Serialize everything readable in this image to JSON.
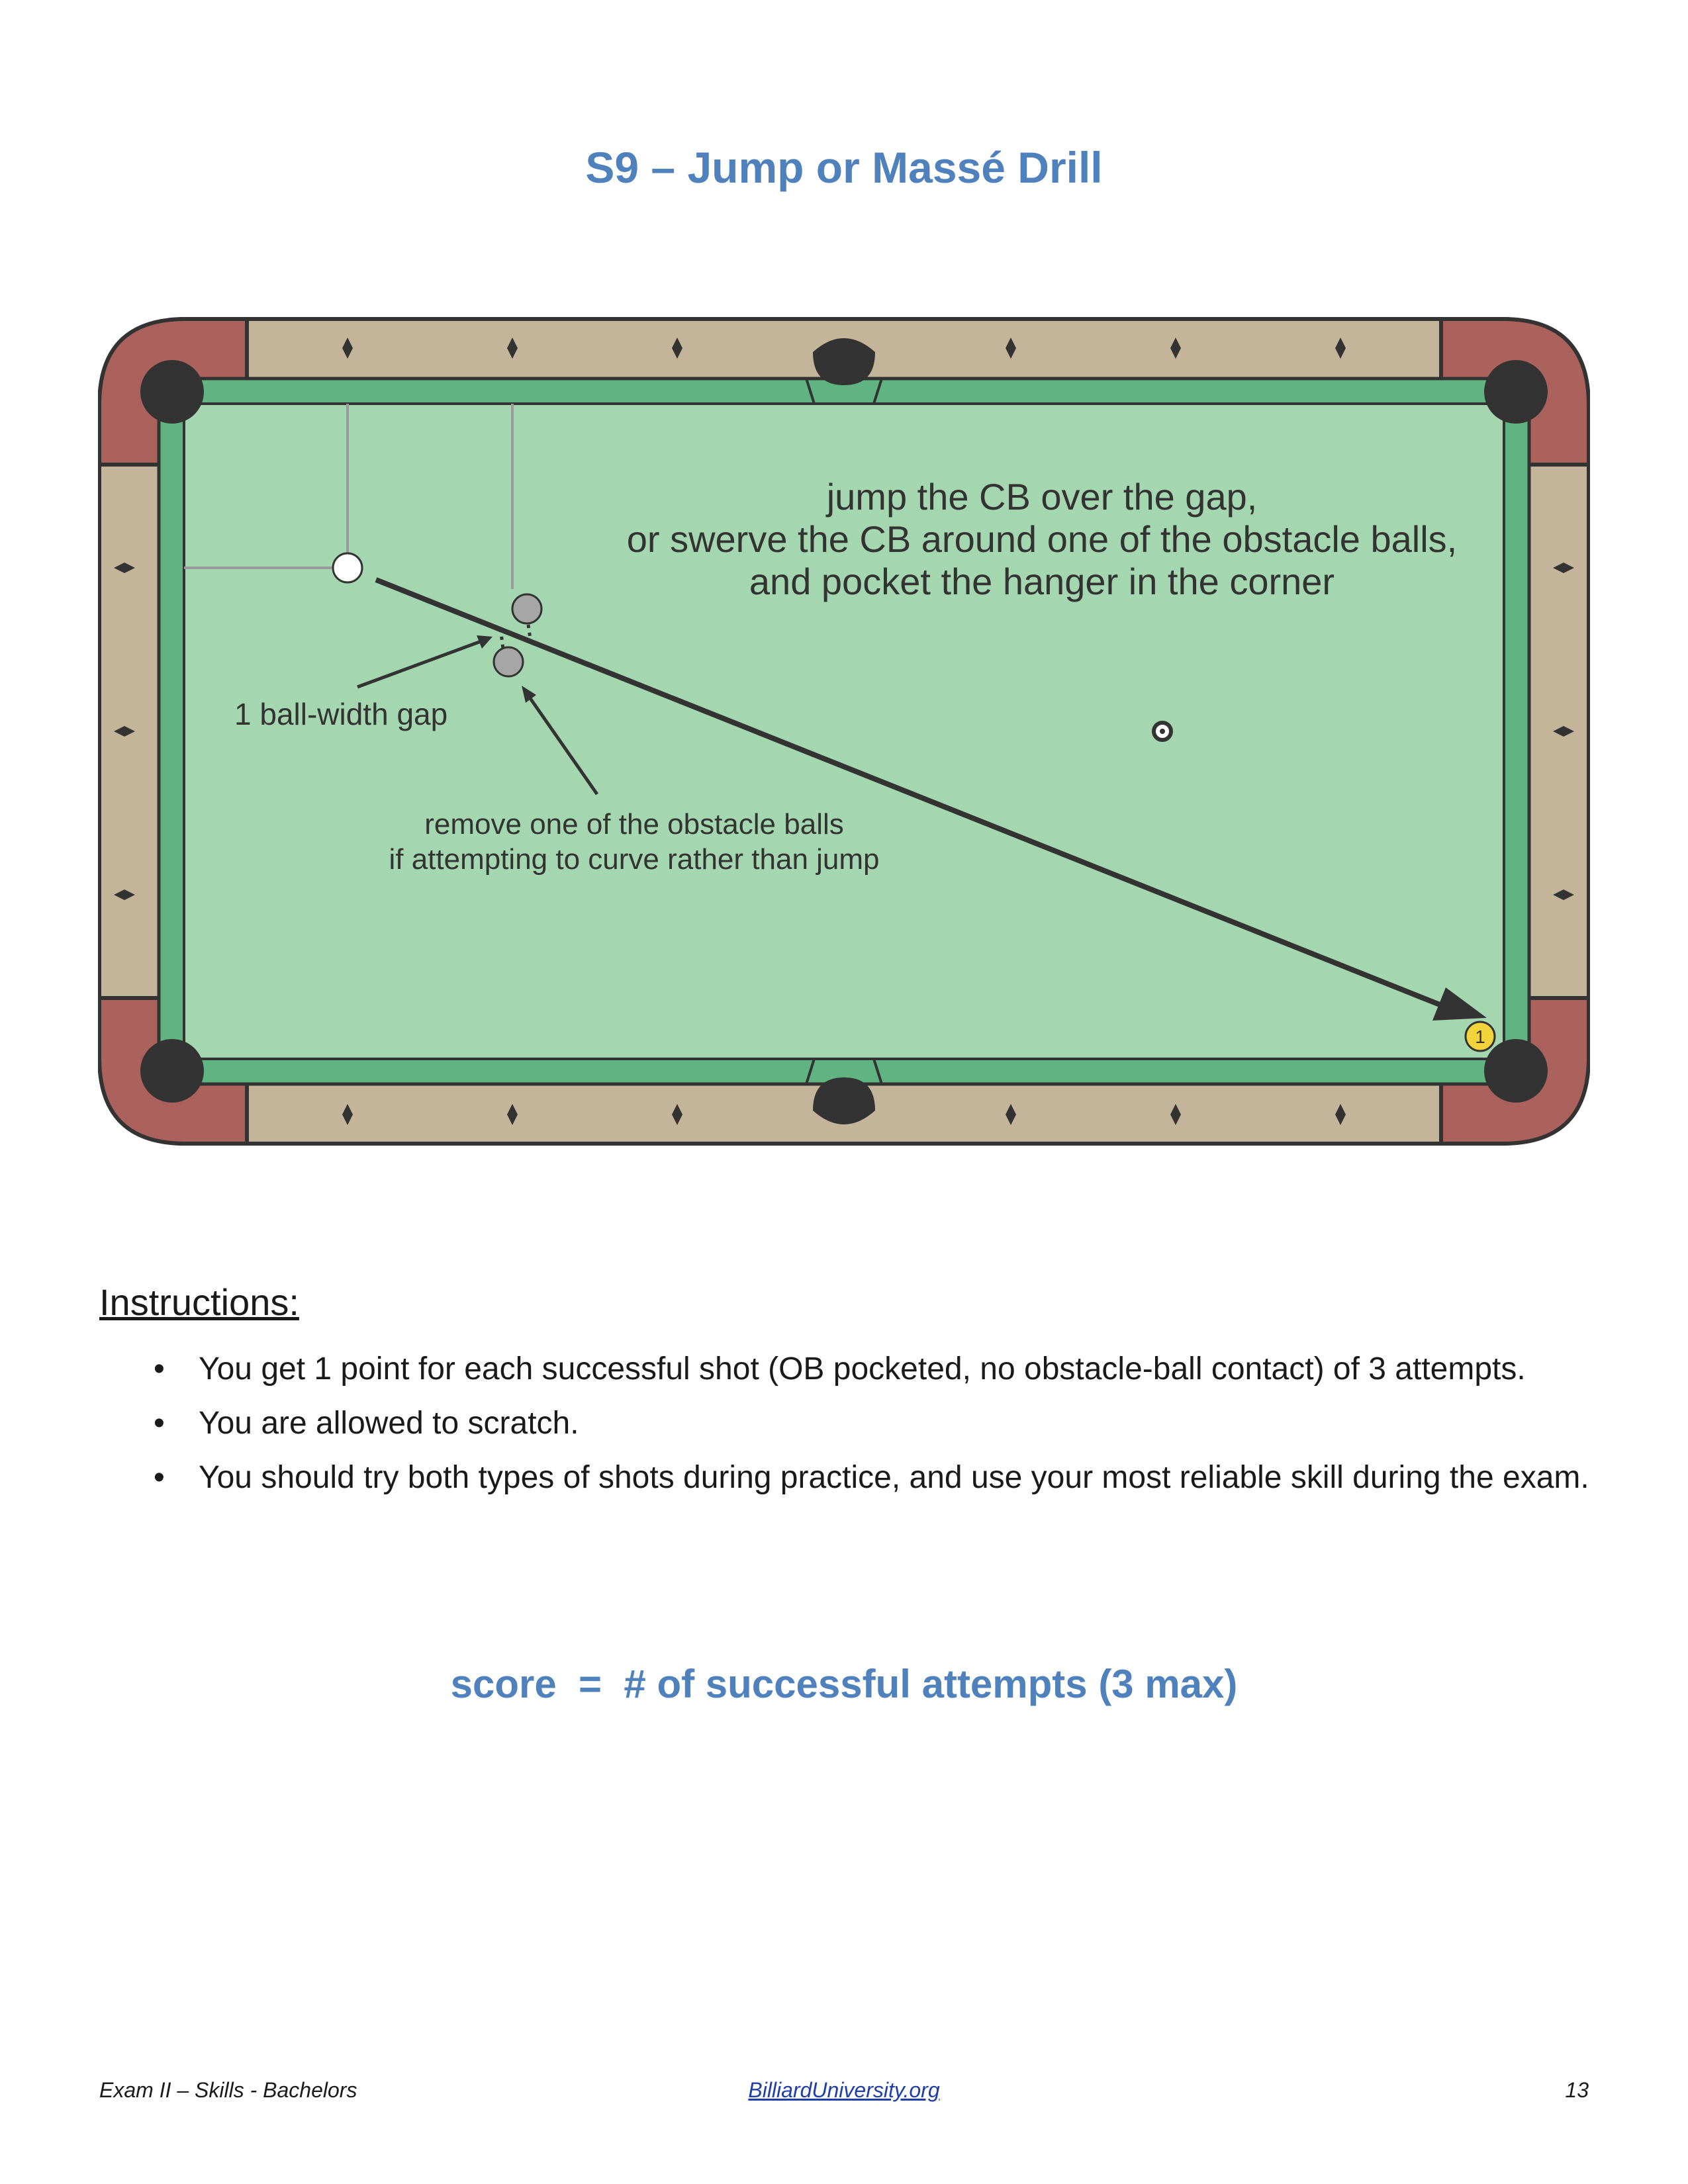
{
  "title": "S9 – Jump or Massé Drill",
  "diagram": {
    "top_note": [
      "jump the CB over the gap,",
      "or swerve the CB around one of the obstacle balls,",
      "and pocket the hanger in the corner"
    ],
    "gap_label": "1 ball-width gap",
    "remove_note": [
      "remove one of the obstacle balls",
      "if attempting to curve rather than jump"
    ],
    "object_ball_number": "1",
    "colors": {
      "cloth": "#a4d6b0",
      "cushion": "#5fb482",
      "rail_wood": "#c4b59a",
      "corner_wood": "#ab625c",
      "pocket": "#333333",
      "object_ball": "#f2d33c",
      "obstacle_ball": "#a6a6a6"
    }
  },
  "instructions": {
    "heading": "Instructions:",
    "items": [
      "You get 1 point for each successful shot (OB pocketed, no obstacle-ball contact) of 3 attempts.",
      "You are allowed to scratch.",
      "You should try both types of shots during practice, and use your most reliable skill during the exam."
    ]
  },
  "score": "score  =  # of successful attempts (3 max)",
  "footer": {
    "left": "Exam II – Skills - Bachelors",
    "center": "BilliardUniversity.org",
    "right": "13"
  }
}
